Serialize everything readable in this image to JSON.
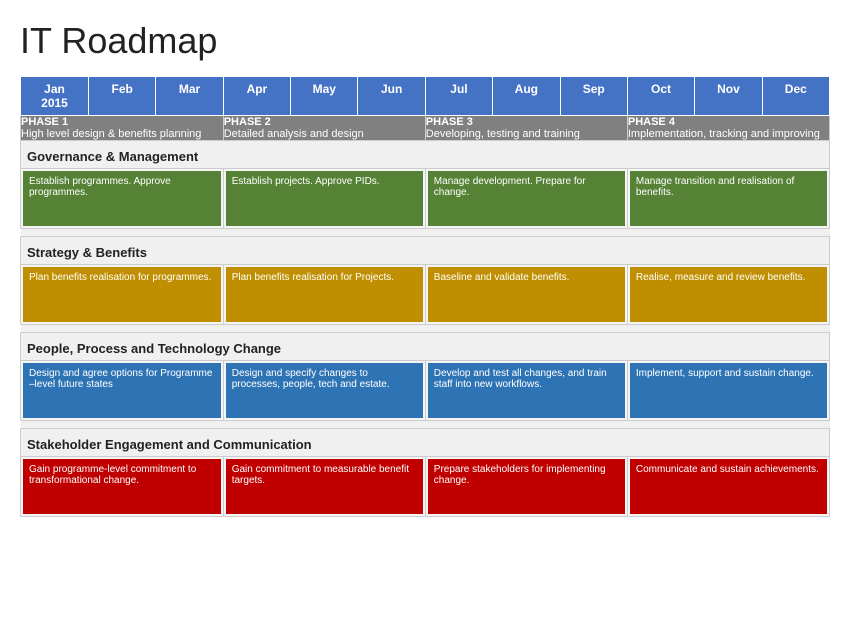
{
  "title": "IT Roadmap",
  "months": [
    "Jan\n2015",
    "Feb",
    "Mar",
    "Apr",
    "May",
    "Jun",
    "Jul",
    "Aug",
    "Sep",
    "Oct",
    "Nov",
    "Dec"
  ],
  "phases": [
    {
      "title": "PHASE 1",
      "subtitle": "High level design & benefits planning",
      "colspan": 3
    },
    {
      "title": "PHASE 2",
      "subtitle": "Detailed analysis and design",
      "colspan": 3
    },
    {
      "title": "PHASE 3",
      "subtitle": "Developing, testing and training",
      "colspan": 3
    },
    {
      "title": "PHASE 4",
      "subtitle": "Implementation, tracking and improving",
      "colspan": 3
    }
  ],
  "sections": [
    {
      "name": "Governance & Management",
      "activities": [
        {
          "label": "Establish programmes. Approve programmes.",
          "color": "green",
          "colspan": 3
        },
        {
          "label": "Establish projects. Approve PIDs.",
          "color": "green",
          "colspan": 3
        },
        {
          "label": "Manage development. Prepare for change.",
          "color": "green",
          "colspan": 3
        },
        {
          "label": "Manage transition and realisation of benefits.",
          "color": "green",
          "colspan": 3
        }
      ]
    },
    {
      "name": "Strategy & Benefits",
      "activities": [
        {
          "label": "Plan benefits realisation for programmes.",
          "color": "yellow",
          "colspan": 3
        },
        {
          "label": "Plan benefits realisation for Projects.",
          "color": "yellow",
          "colspan": 3
        },
        {
          "label": "Baseline and validate benefits.",
          "color": "yellow",
          "colspan": 3
        },
        {
          "label": "Realise, measure and review benefits.",
          "color": "yellow",
          "colspan": 3
        }
      ]
    },
    {
      "name": "People, Process and Technology Change",
      "activities": [
        {
          "label": "Design and agree options for Programme –level future states",
          "color": "blue",
          "colspan": 3
        },
        {
          "label": "Design and specify changes to processes, people, tech and estate.",
          "color": "blue",
          "colspan": 3
        },
        {
          "label": "Develop and test all changes, and train staff into new workflows.",
          "color": "blue",
          "colspan": 3
        },
        {
          "label": "Implement, support and sustain change.",
          "color": "blue",
          "colspan": 3
        }
      ]
    },
    {
      "name": "Stakeholder Engagement and Communication",
      "activities": [
        {
          "label": "Gain programme-level commitment to transformational change.",
          "color": "red",
          "colspan": 3
        },
        {
          "label": "Gain commitment to measurable benefit targets.",
          "color": "red",
          "colspan": 3
        },
        {
          "label": "Prepare stakeholders for implementing change.",
          "color": "red",
          "colspan": 3
        },
        {
          "label": "Communicate and sustain achievements.",
          "color": "red",
          "colspan": 3
        }
      ]
    }
  ]
}
